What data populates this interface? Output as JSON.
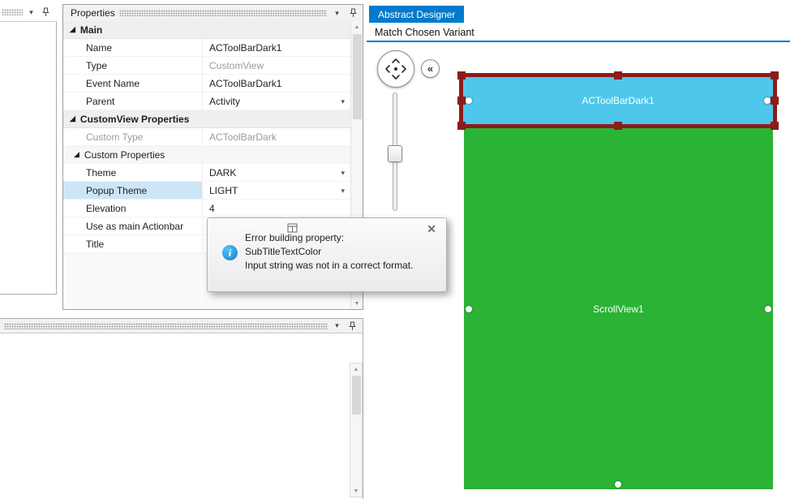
{
  "colors": {
    "accent": "#007ACC",
    "toolbar_fill": "#4EC7EA",
    "scrollview_fill": "#2BB335",
    "selection": "#8E1B1B",
    "row_highlight": "#CDE6F7"
  },
  "icons": {
    "panel_menu": "▾",
    "dropdown": "▾",
    "category_expanded": "◢",
    "scroll_up": "▲",
    "scroll_down": "▼",
    "close": "✕",
    "collapse": "«",
    "info": "i"
  },
  "properties_panel": {
    "title": "Properties",
    "rows": [
      {
        "type": "category",
        "label": "Main"
      },
      {
        "type": "item",
        "label": "Name",
        "value": "ACToolBarDark1"
      },
      {
        "type": "item",
        "label": "Type",
        "value": "CustomView",
        "muted": true
      },
      {
        "type": "item",
        "label": "Event Name",
        "value": "ACToolBarDark1"
      },
      {
        "type": "item",
        "label": "Parent",
        "value": "Activity",
        "dropdown": true
      },
      {
        "type": "category",
        "label": "CustomView Properties"
      },
      {
        "type": "item",
        "label": "Custom Type",
        "value": "ACToolBarDark",
        "muted": true
      },
      {
        "type": "subcategory",
        "label": "Custom Properties"
      },
      {
        "type": "item",
        "label": "Theme",
        "value": "DARK",
        "dropdown": true
      },
      {
        "type": "item",
        "label": "Popup Theme",
        "value": "LIGHT",
        "dropdown": true,
        "selected": true
      },
      {
        "type": "item",
        "label": "Elevation",
        "value": "4"
      },
      {
        "type": "item",
        "label": "Use as main Actionbar",
        "value": ""
      },
      {
        "type": "item",
        "label": "Title",
        "value": ""
      }
    ]
  },
  "error_popup": {
    "line1": "Error building property:",
    "line2": "SubTitleTextColor",
    "line3": "Input string was not in a correct format."
  },
  "designer": {
    "tab_label": "Abstract Designer",
    "variant_label": "Match Chosen Variant",
    "toolbar_view_label": "ACToolBarDark1",
    "scrollview_label": "ScrollView1"
  }
}
